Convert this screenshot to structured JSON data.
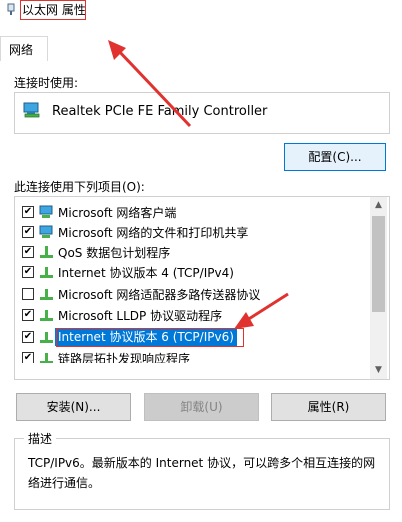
{
  "window": {
    "title": "以太网 属性"
  },
  "tabs": [
    {
      "label": "网络",
      "selected": true
    }
  ],
  "connect_using": {
    "label": "连接时使用:",
    "adapter": "Realtek PCIe FE Family Controller",
    "configure_button": "配置(C)..."
  },
  "items": {
    "label": "此连接使用下列项目(O):",
    "list": [
      {
        "checked": true,
        "label": "Microsoft 网络客户端",
        "icon": "network-client-icon"
      },
      {
        "checked": true,
        "label": "Microsoft 网络的文件和打印机共享",
        "icon": "file-printer-sharing-icon"
      },
      {
        "checked": true,
        "label": "QoS 数据包计划程序",
        "icon": "qos-scheduler-icon"
      },
      {
        "checked": true,
        "label": "Internet 协议版本 4 (TCP/IPv4)",
        "icon": "protocol-icon"
      },
      {
        "checked": false,
        "label": "Microsoft 网络适配器多路传送器协议",
        "icon": "protocol-icon"
      },
      {
        "checked": true,
        "label": "Microsoft LLDP 协议驱动程序",
        "icon": "protocol-icon"
      },
      {
        "checked": true,
        "label": "Internet 协议版本 6 (TCP/IPv6)",
        "icon": "protocol-icon",
        "selected": true
      },
      {
        "checked": true,
        "label": "链路层拓扑发现响应程序",
        "icon": "protocol-icon"
      }
    ]
  },
  "buttons": {
    "install": "安装(N)...",
    "uninstall": "卸载(U)",
    "properties": "属性(R)"
  },
  "description": {
    "title": "描述",
    "text": "TCP/IPv6。最新版本的 Internet 协议，可以跨多个相互连接的网络进行通信。"
  },
  "colors": {
    "selection": "#0078d7",
    "annotation": "#e0322f"
  }
}
